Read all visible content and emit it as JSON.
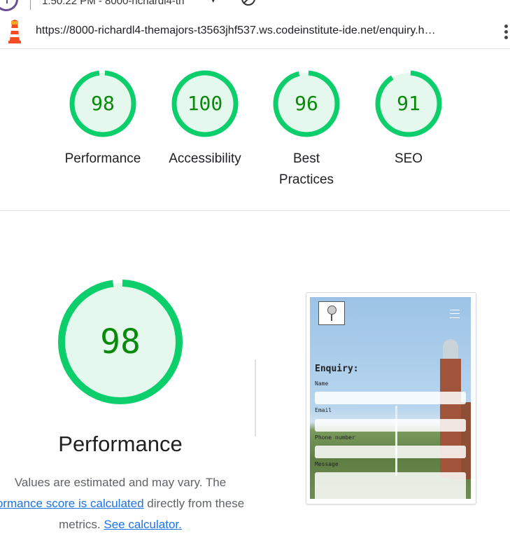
{
  "topbar": {
    "title": "1:50:22 PM - 8000-richardl4-th",
    "dropdown_glyph": "▾"
  },
  "urlbar": {
    "url": "https://8000-richardl4-themajors-t3563jhf537.ws.codeinstitute-ide.net/enquiry.h…"
  },
  "colors": {
    "pass": "#0cce6b",
    "pass_bg": "#e5f8ee",
    "score_text": "#0a8a0a",
    "link": "#1a73e8"
  },
  "scores": [
    {
      "label": "Performance",
      "value": "98",
      "score": 98
    },
    {
      "label": "Accessibility",
      "value": "100",
      "score": 100
    },
    {
      "label": "Best Practices",
      "value": "96",
      "score": 96
    },
    {
      "label": "SEO",
      "value": "91",
      "score": 91
    }
  ],
  "detail": {
    "value": "98",
    "score": 98,
    "title": "Performance",
    "note_prefix": "Values are estimated and may vary. The",
    "note_link1": "ormance score is calculated",
    "note_middle": "directly from these metrics.",
    "note_link2": "See calculator."
  },
  "preview": {
    "heading": "Enquiry:",
    "fields": [
      "Name",
      "Email",
      "Phone number",
      "Message"
    ]
  }
}
